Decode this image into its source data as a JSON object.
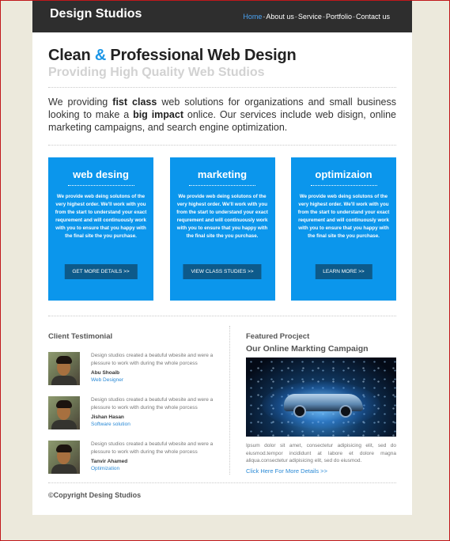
{
  "header": {
    "logo": "Design Studios",
    "nav": [
      "Home",
      "About us",
      "Service",
      "Portfolio",
      "Contact us"
    ],
    "nav_separator": "-"
  },
  "hero": {
    "title_part1": "Clean ",
    "title_amp": "&",
    "title_part2": " Professional Web Design",
    "subtitle": "Providing High Quality Web Studios"
  },
  "intro": {
    "t1": "We providing ",
    "b1": "fist class",
    "t2": " web solutions for organizations and small business looking to make a ",
    "b2": "big impact",
    "t3": " onlice. Our services include web disign, online marketing campaigns, and search engine optimization."
  },
  "services": [
    {
      "title": "web desing",
      "text": "We provide web deing solutons of the very highest order. We'll work with you from the start to understand your exact requrement and will continuously work with you to ensure that you happy with the final site the you purchase.",
      "button": "GET MORE DETAILS >>"
    },
    {
      "title": "marketing",
      "text": "We provide web deing solutons of the very highest order. We'll work with you from the start to understand your exact requrement and will continuously work with you to ensure that you happy with the final site the you purchase.",
      "button": "VIEW CLASS STUDIES >>"
    },
    {
      "title": "optimizaion",
      "text": "We provide web deing solutons of the very highest order. We'll work with you from the start to understand your exact requrement and will continuously work with you to ensure that you happy with the final site the you purchase.",
      "button": "LEARN MORE >>"
    }
  ],
  "testimonials": {
    "title": "Client Testimonial",
    "items": [
      {
        "text": "Design studios created a beatuful wbesite and were a plessure to work with during the whole porcess",
        "name": "Abu Shoaib",
        "role": "Web Designer"
      },
      {
        "text": "Design studios created a beatuful wbesite and were a plessure to work with during the whole porcess",
        "name": "Jishan Hasan",
        "role": "Software solution"
      },
      {
        "text": "Design studios created a beatuful wbesite and were a plessure to work with during the whole porcess",
        "name": "Tanvir Ahamed",
        "role": "Optimization"
      }
    ]
  },
  "project": {
    "title": "Featured Procject",
    "subtitle": "Our Online Markting Campaign",
    "text": "Ipsum dolor sit amet, consectetur adipisicing elit, sed do eiusmod.tempor incididunt at labore et dolore magna aliqua.consectetur adipisicing elit, sed do eiusmod.",
    "link": "Click Here For More Details >>"
  },
  "footer": {
    "copyright": "©Copyright Desing Studios"
  }
}
